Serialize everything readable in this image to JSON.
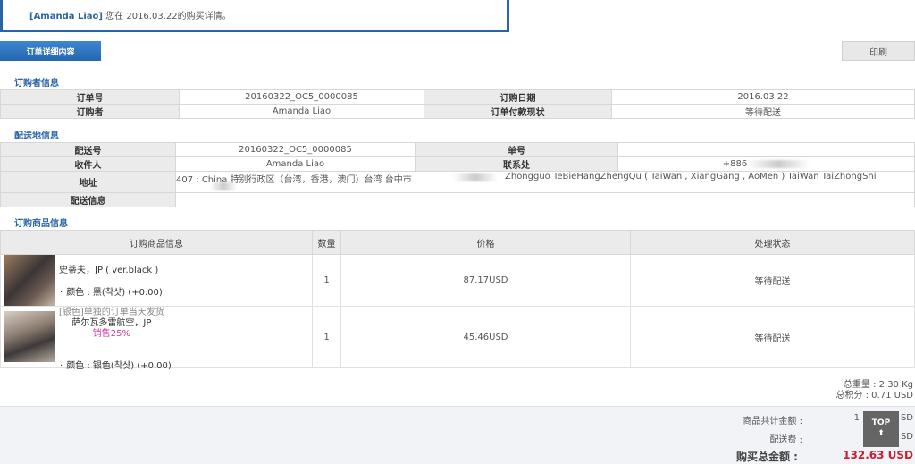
{
  "notice": {
    "name": "[Amanda Liao]",
    "text": " 您在 2016.03.22的购买详情。"
  },
  "tabs": {
    "detail": "订单详细内容",
    "print": "印刷"
  },
  "orderer": {
    "title": "订购者信息",
    "order_no_label": "订单号",
    "order_no": "20160322_OC5_0000085",
    "order_date_label": "订购日期",
    "order_date": "2016.03.22",
    "buyer_label": "订购者",
    "buyer": "Amanda Liao",
    "pay_status_label": "订单付款现状",
    "pay_status": "等待配送"
  },
  "delivery": {
    "title": "配送地信息",
    "ship_no_label": "配送号",
    "ship_no": "20160322_OC5_0000085",
    "doc_no_label": "单号",
    "doc_no": "",
    "recipient_label": "收件人",
    "recipient": "Amanda Liao",
    "contact_label": "联系处",
    "contact": "+886",
    "address_label": "地址",
    "address_cn": "407 : China 特别行政区（台湾，香港，澳门）台湾 台中市",
    "address_en": "Zhongguo TeBieHangZhengQu ( TaiWan , XiangGang , AoMen ) TaiWan TaiZhongShi",
    "info_label": "配送信息",
    "info": ""
  },
  "products": {
    "title": "订购商品信息",
    "headers": {
      "info": "订购商品信息",
      "qty": "数量",
      "price": "价格",
      "status": "处理状态"
    },
    "items": [
      {
        "name": "史蒂夫，JP ( ver.black )",
        "option": "颜色 : 黑(착샷) (+0.00)",
        "qty": "1",
        "price": "87.17USD",
        "status": "等待配送",
        "thumb": "product-photo"
      },
      {
        "badge": "[银色]单独的订单当天发货",
        "name": "萨尔瓦多雷航空，JP",
        "sale": "销售25%",
        "option": "颜色 : 银色(착샷) (+0.00)",
        "qty": "1",
        "price": "45.46USD",
        "status": "等待配送",
        "thumb": "product-photo"
      }
    ]
  },
  "totals": {
    "weight": "总重量 : 2.30 Kg",
    "points": "总积分 : 0.71 USD"
  },
  "summary": {
    "goods_label": "商品共计金额 :",
    "goods_value": "1",
    "goods_value_tail": "SD",
    "shipping_label": "配送费 :",
    "shipping_value": "SD",
    "grand_label": "购买总金额 :",
    "grand_value": "132.63 USD"
  },
  "top_button": {
    "label": "TOP",
    "arrow": "⬆"
  },
  "colors": {
    "accent": "#2b63a8",
    "header_bg": "#ebebeb",
    "price_red": "#c8202f",
    "sale_pink": "#d23a9a"
  }
}
